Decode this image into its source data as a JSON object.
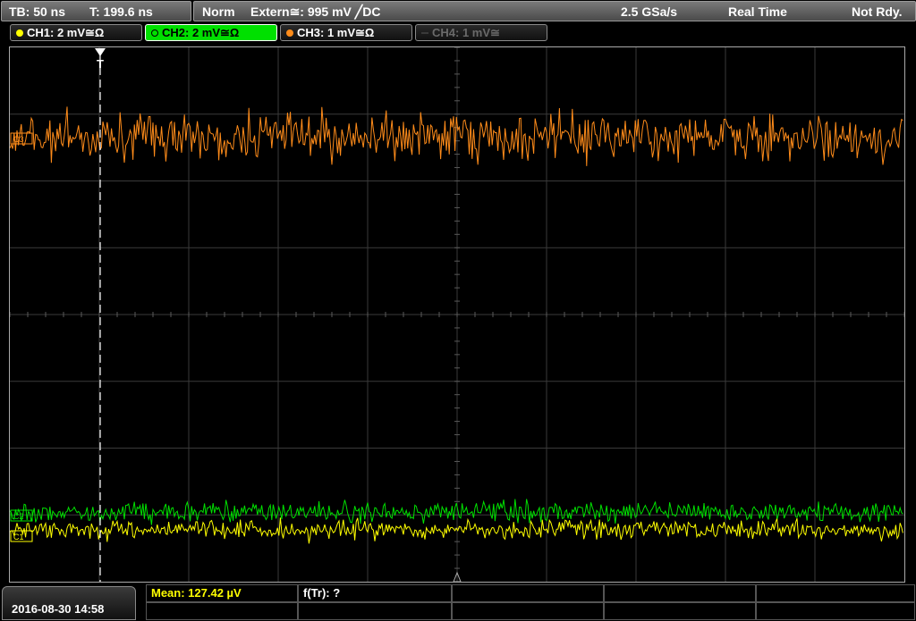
{
  "status": {
    "timebase": "TB: 50 ns",
    "trigger_time": "T: 199.6 ns",
    "trigger_mode": "Norm",
    "trigger_source": "Extern≅: 995 mV ╱DC",
    "sample_rate": "2.5 GSa/s",
    "acq_mode": "Real Time",
    "state": "Not Rdy."
  },
  "channels": [
    {
      "label": "CH1: 2 mV≅Ω",
      "color": "#ffff00"
    },
    {
      "label": "CH2: 2 mV≅Ω",
      "color": "#00e000"
    },
    {
      "label": "CH3: 1 mV≅Ω",
      "color": "#ff8c1a"
    },
    {
      "label": "CH4: 1 mV≅",
      "color": "#5a5a5a"
    }
  ],
  "measurements": {
    "mean": "Mean: 127.42 µV",
    "rise": "f(Tr): ?"
  },
  "datetime": "2016-08-30 14:58",
  "markers": {
    "trigger": "T",
    "ch3_label": "C3",
    "ch2_label": "C2",
    "ch1_label": "C1"
  }
}
